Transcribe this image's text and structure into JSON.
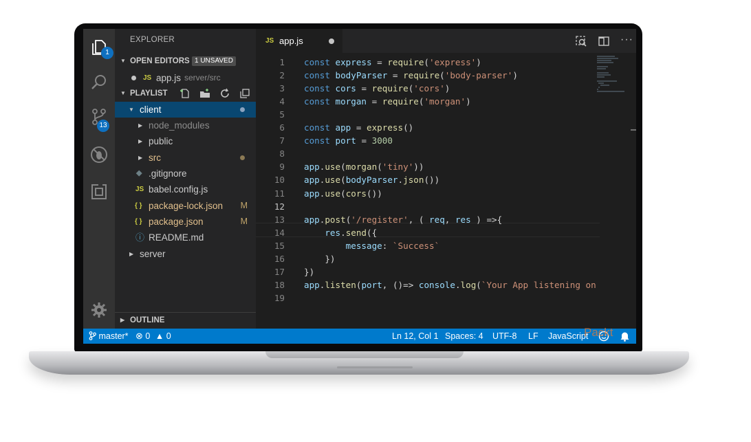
{
  "sidebar": {
    "title": "EXPLORER",
    "open_editors": {
      "label": "OPEN EDITORS",
      "badge": "1 UNSAVED",
      "file_icon": "JS",
      "file_name": "app.js",
      "file_path": "server/src"
    },
    "playlist": {
      "label": "PLAYLIST"
    },
    "tree": [
      {
        "name": "client",
        "icon": "",
        "status": ""
      },
      {
        "name": "node_modules",
        "icon": "",
        "status": ""
      },
      {
        "name": "public",
        "icon": "",
        "status": ""
      },
      {
        "name": "src",
        "icon": "",
        "status": ""
      },
      {
        "name": ".gitignore",
        "icon": "◆",
        "status": ""
      },
      {
        "name": "babel.config.js",
        "icon": "JS",
        "status": ""
      },
      {
        "name": "package-lock.json",
        "icon": "{ }",
        "status": "M"
      },
      {
        "name": "package.json",
        "icon": "{ }",
        "status": "M"
      },
      {
        "name": "README.md",
        "icon": "ⓘ",
        "status": ""
      },
      {
        "name": "server",
        "icon": "",
        "status": ""
      }
    ],
    "outline": {
      "label": "OUTLINE"
    }
  },
  "activity": {
    "explorer_badge": "1",
    "scm_badge": "13"
  },
  "tab": {
    "icon": "JS",
    "label": "app.js"
  },
  "editor": {
    "line_numbers": [
      "1",
      "2",
      "3",
      "4",
      "5",
      "6",
      "7",
      "8",
      "9",
      "10",
      "11",
      "12",
      "13",
      "14",
      "15",
      "16",
      "17",
      "18",
      "19"
    ],
    "lines": [
      "const express = require('express')",
      "const bodyParser = require('body-parser')",
      "const cors = require('cors')",
      "const morgan = require('morgan')",
      "",
      "const app = express()",
      "const port = 3000",
      "",
      "app.use(morgan('tiny'))",
      "app.use(bodyParser.json())",
      "app.use(cors())",
      "",
      "app.post('/register', ( req, res ) =>{",
      "    res.send({",
      "        message: `Success`",
      "    })",
      "})",
      "app.listen(port, ()=> console.log(`Your App listening on",
      ""
    ]
  },
  "status": {
    "branch": "master*",
    "errors": "0",
    "warnings": "0",
    "position": "Ln 12, Col 1",
    "spaces": "Spaces: 4",
    "encoding": "UTF-8",
    "eol": "LF",
    "language": "JavaScript"
  },
  "watermark": "Packt",
  "colors": {
    "accent": "#007acc",
    "selection": "#094771",
    "modified": "#c0a46a"
  }
}
